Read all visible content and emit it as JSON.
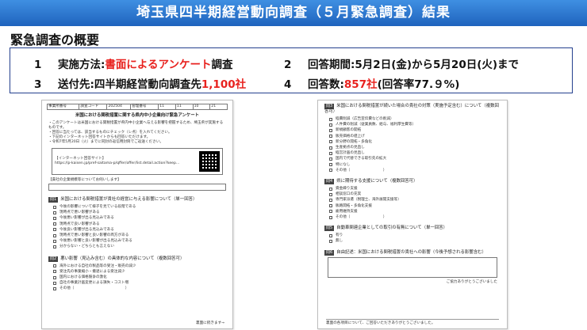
{
  "banner": {
    "title": "埼玉県四半期経営動向調査（５月緊急調査）結果"
  },
  "section": {
    "title": "緊急調査の概要"
  },
  "summary": {
    "items": [
      {
        "num": "1",
        "label": "実施方法:",
        "value_red": "書面によるアンケート",
        "value_tail": "調査"
      },
      {
        "num": "2",
        "label": "回答期間:",
        "value": "5月2日(金)から5月20日(火)まで"
      },
      {
        "num": "3",
        "label": "送付先:四半期経営動向調査先",
        "value_red": "1,100社"
      },
      {
        "num": "4",
        "label": "回答数:",
        "value_red": "857社",
        "value_tail": "(回答率77.９%)"
      }
    ]
  },
  "left_doc": {
    "header_cells": [
      "事業所番号",
      "調査コード",
      "202504",
      "管理番号",
      "11",
      "11",
      "10",
      "21"
    ],
    "title": "米国における関税措置に関する県内中小企業向け緊急アンケート",
    "intro": [
      "・このアンケートは米国における関税措置が県内中小企業へ与える影響を把握するため、埼玉県が実施するものです。",
      "・回答に当たっては、該当するものにチェック（レ点）を入れてください。",
      "・下記のインターネット回答サイトからも回答いただけます。",
      "・令和7年5月20日（火）までに同封の返信用封筒でご返送ください。"
    ],
    "web_title": "【インターネット回答サイト】",
    "web_url": "https://p-kaisen.jp/pref-saitama-p/qffer/offer/list.detail.action?keep...",
    "q0_header": "【貴社の企業規模等についてお伺いします】",
    "q1_title": "米国における関税措置が貴社の経営に与える影響について（単一回答）",
    "q1_options": [
      "今後の影響について様子を見ている段階である",
      "現時点で悪い影響がある",
      "今後悪い影響が出る見込みである",
      "現時点で良い影響がある",
      "今後良い影響が出る見込みである",
      "現時点で悪い影響と良い影響の両方がある",
      "今後悪い影響と良い影響が出る見込みである",
      "分からない・どちらとも言えない"
    ],
    "q2_title": "悪い影響（見込み含む）の具体的な内容について（複数回答可）",
    "q2_options": [
      "海外における自社の製品等の受注・販売の減少",
      "受注先の事業縮小・撤退による受注減少",
      "国内における価格競争の激化",
      "自社の事業計画変更による損失・コスト増",
      "その他（　　　　　　　　　　　　　　）"
    ],
    "footer": "裏面に続きます→"
  },
  "right_doc": {
    "q3_title": "米国における関税措置が続いた場合の貴社の対策（実施予定含む）について（複数回答可）",
    "q3_options": [
      "経費削減（広告宣伝費などの削減）",
      "人件費の削減（従業員数、給与、福利厚生費等）",
      "新規顧客の開拓",
      "販売価格の値上げ",
      "新分野の開拓・多角化",
      "生産拠点の見直し",
      "経営計画の見直し",
      "国内で代替できる取引先の拡大",
      "特になし",
      "その他（　　　　　　　　　）"
    ],
    "q4_title": "県に期待する支援について（複数回答可）",
    "q4_options": [
      "資金繰り支援",
      "相談窓口の充実",
      "専門家派遣（税理士、海外展開支援等）",
      "販路開拓・多角化支援",
      "雇用維持支援",
      "その他（　　　　　　　　　）"
    ],
    "q5_title": "自動車関連企業としての取引の有無について（単一回答）",
    "q5_options": [
      "有り",
      "無し"
    ],
    "q6_title": "自由記述：米国における関税措置の貴社への影響（今後予想される影響含む）",
    "footer_note": "裏面の各項目について、ご回答いただきありがとうございました。",
    "thanks": "ご協力ありがとうございました"
  }
}
